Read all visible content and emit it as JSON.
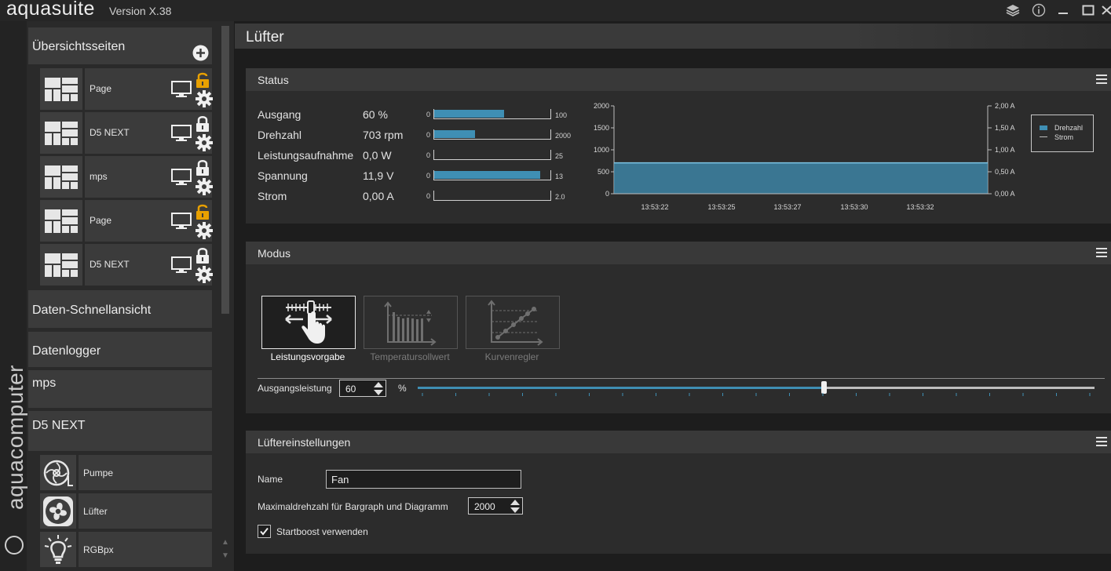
{
  "app": {
    "name": "aquasuite",
    "version": "Version X.38",
    "brand_vertical": "aquacomputer"
  },
  "sidebar": {
    "overview_header": "Übersichtsseiten",
    "pages": [
      {
        "label": "Page",
        "lock": "unlocked"
      },
      {
        "label": "D5 NEXT",
        "lock": "locked"
      },
      {
        "label": "mps",
        "lock": "locked"
      },
      {
        "label": "Page",
        "lock": "unlocked"
      },
      {
        "label": "D5 NEXT",
        "lock": "locked"
      }
    ],
    "quick_view": "Daten-Schnellansicht",
    "datalogger": "Datenlogger",
    "mps": "mps",
    "d5next": "D5 NEXT",
    "devices": [
      {
        "label": "Pumpe",
        "icon": "pump-icon"
      },
      {
        "label": "Lüfter",
        "icon": "fan-icon"
      },
      {
        "label": "RGBpx",
        "icon": "bulb-icon"
      }
    ]
  },
  "main": {
    "title": "Lüfter",
    "status": {
      "title": "Status",
      "rows": [
        {
          "label": "Ausgang",
          "value": "60 %",
          "min": "0",
          "max": "100",
          "fill": 0.6
        },
        {
          "label": "Drehzahl",
          "value": "703 rpm",
          "min": "0",
          "max": "2000",
          "fill": 0.352
        },
        {
          "label": "Leistungsaufnahme",
          "value": "0,0 W",
          "min": "0",
          "max": "25",
          "fill": 0
        },
        {
          "label": "Spannung",
          "value": "11,9 V",
          "min": "0",
          "max": "13",
          "fill": 0.915
        },
        {
          "label": "Strom",
          "value": "0,00 A",
          "min": "0",
          "max": "2.0",
          "fill": 0
        }
      ]
    },
    "modus": {
      "title": "Modus",
      "modes": [
        "Leistungsvorgabe",
        "Temperatursollwert",
        "Kurvenregler"
      ],
      "active_mode": "Leistungsvorgabe",
      "output_label": "Ausgangsleistung",
      "output_value": "60",
      "output_unit": "%",
      "output_fraction": 0.6
    },
    "settings": {
      "title": "Lüftereinstellungen",
      "name_label": "Name",
      "name_value": "Fan",
      "maxrpm_label": "Maximaldrehzahl für Bargraph und Diagramm",
      "maxrpm_value": "2000",
      "startboost_label": "Startboost verwenden",
      "startboost_checked": true
    }
  },
  "colors": {
    "accent": "#3f8fb4",
    "lock_open": "#e8a000"
  },
  "chart_data": {
    "type": "area",
    "x": [
      "13:53:22",
      "13:53:25",
      "13:53:27",
      "13:53:30",
      "13:53:32"
    ],
    "y_left_ticks": [
      "2000",
      "1500",
      "1000",
      "500",
      "0"
    ],
    "y_right_ticks": [
      "2,00 A",
      "1,50 A",
      "1,00 A",
      "0,50 A",
      "0,00 A"
    ],
    "ylim_left": [
      0,
      2000
    ],
    "ylim_right": [
      0,
      2
    ],
    "series": [
      {
        "name": "Drehzahl",
        "values": [
          703,
          703,
          703,
          703,
          703
        ],
        "color": "#3f8fb4"
      },
      {
        "name": "Strom",
        "values": [
          0,
          0,
          0,
          0,
          0
        ],
        "color": "#bdbdbd"
      }
    ],
    "legend_position": "right"
  }
}
